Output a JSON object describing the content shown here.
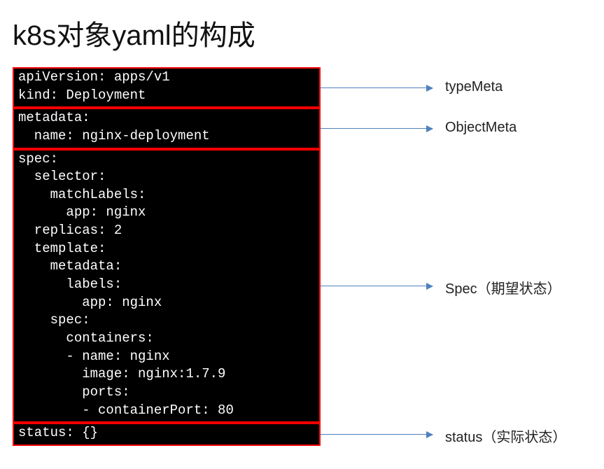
{
  "title": "k8s对象yaml的构成",
  "blocks": [
    {
      "lines": [
        "apiVersion: apps/v1",
        "kind: Deployment"
      ],
      "label": "typeMeta"
    },
    {
      "lines": [
        "metadata:",
        "  name: nginx-deployment"
      ],
      "label": "ObjectMeta"
    },
    {
      "lines": [
        "spec:",
        "  selector:",
        "    matchLabels:",
        "      app: nginx",
        "  replicas: 2",
        "  template:",
        "    metadata:",
        "      labels:",
        "        app: nginx",
        "    spec:",
        "      containers:",
        "      - name: nginx",
        "        image: nginx:1.7.9",
        "        ports:",
        "        - containerPort: 80"
      ],
      "label": "Spec（期望状态）"
    },
    {
      "lines": [
        "status: {}"
      ],
      "label": "status（实际状态）"
    }
  ]
}
